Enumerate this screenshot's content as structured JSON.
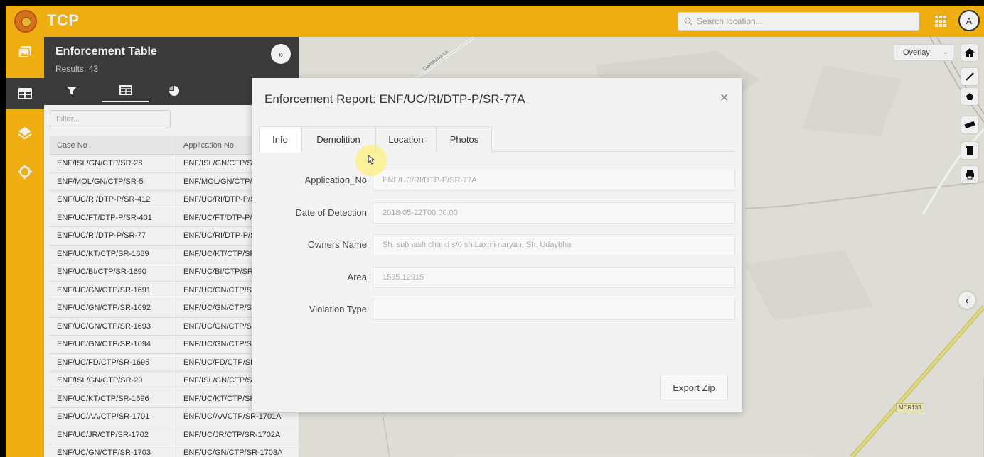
{
  "app": {
    "title": "TCP"
  },
  "header": {
    "search_placeholder": "Search location...",
    "avatar_initial": "A"
  },
  "panel": {
    "title": "Enforcement Table",
    "results": "Results: 43",
    "filter_placeholder": "Filter...",
    "columns": [
      "Case No",
      "Application No"
    ],
    "rows": [
      [
        "ENF/ISL/GN/CTP/SR-28",
        "ENF/ISL/GN/CTP/SR"
      ],
      [
        "ENF/MOL/GN/CTP/SR-5",
        "ENF/MOL/GN/CTP/S"
      ],
      [
        "ENF/UC/RI/DTP-P/SR-412",
        "ENF/UC/RI/DTP-P/S"
      ],
      [
        "ENF/UC/FT/DTP-P/SR-401",
        "ENF/UC/FT/DTP-P/S"
      ],
      [
        "ENF/UC/RI/DTP-P/SR-77",
        "ENF/UC/RI/DTP-P/S"
      ],
      [
        "ENF/UC/KT/CTP/SR-1689",
        "ENF/UC/KT/CTP/SR-"
      ],
      [
        "ENF/UC/BI/CTP/SR-1690",
        "ENF/UC/BI/CTP/SR-"
      ],
      [
        "ENF/UC/GN/CTP/SR-1691",
        "ENF/UC/GN/CTP/SR"
      ],
      [
        "ENF/UC/GN/CTP/SR-1692",
        "ENF/UC/GN/CTP/SR"
      ],
      [
        "ENF/UC/GN/CTP/SR-1693",
        "ENF/UC/GN/CTP/SR"
      ],
      [
        "ENF/UC/GN/CTP/SR-1694",
        "ENF/UC/GN/CTP/SR"
      ],
      [
        "ENF/UC/FD/CTP/SR-1695",
        "ENF/UC/FD/CTP/SR"
      ],
      [
        "ENF/ISL/GN/CTP/SR-29",
        "ENF/ISL/GN/CTP/SR"
      ],
      [
        "ENF/UC/KT/CTP/SR-1696",
        "ENF/UC/KT/CTP/SR-"
      ],
      [
        "ENF/UC/AA/CTP/SR-1701",
        "ENF/UC/AA/CTP/SR-1701A"
      ],
      [
        "ENF/UC/JR/CTP/SR-1702",
        "ENF/UC/JR/CTP/SR-1702A"
      ],
      [
        "ENF/UC/GN/CTP/SR-1703",
        "ENF/UC/GN/CTP/SR-1703A"
      ]
    ]
  },
  "map": {
    "overlay_label": "Overlay",
    "road_labels": [
      "MDR133",
      "Damdama La"
    ]
  },
  "modal": {
    "title": "Enforcement Report: ENF/UC/RI/DTP-P/SR-77A",
    "tabs": [
      "Info",
      "Demolition",
      "Location",
      "Photos"
    ],
    "fields": [
      {
        "label": "Application_No",
        "value": "ENF/UC/RI/DTP-P/SR-77A"
      },
      {
        "label": "Date of Detection",
        "value": "2018-05-22T00:00:00"
      },
      {
        "label": "Owners Name",
        "value": "Sh. subhash chand s/0 sh Laxmi naryan, Sh. Udaybha"
      },
      {
        "label": "Area",
        "value": "1535.12915"
      },
      {
        "label": "Violation Type",
        "value": ""
      }
    ],
    "export_label": "Export Zip"
  },
  "colors": {
    "brand": "#fdb813",
    "panel_dark": "#3f3f3f"
  }
}
